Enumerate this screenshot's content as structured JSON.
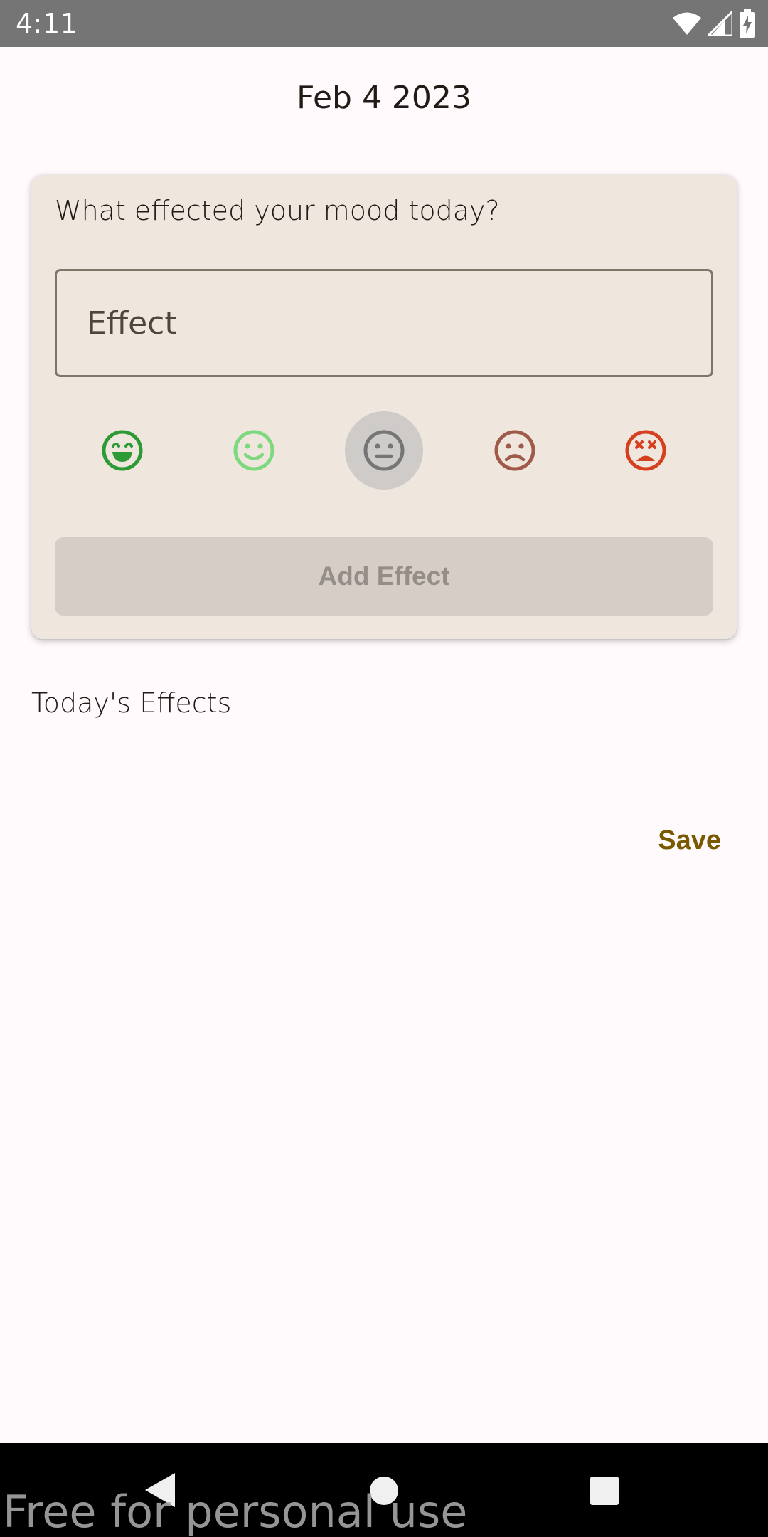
{
  "status_bar": {
    "time": "4:11",
    "icons": [
      "wifi-icon",
      "signal-icon",
      "battery-charging-icon"
    ]
  },
  "header": {
    "date": "Feb 4 2023"
  },
  "effect_card": {
    "question": "What effected your mood today?",
    "effect_field": {
      "label": "Effect",
      "value": ""
    },
    "moods": [
      {
        "name": "very-happy",
        "icon": "grin-face-icon",
        "color": "#2e9a35",
        "selected": false
      },
      {
        "name": "happy",
        "icon": "smile-face-icon",
        "color": "#7dd87f",
        "selected": false
      },
      {
        "name": "neutral",
        "icon": "neutral-face-icon",
        "color": "#757575",
        "selected": true
      },
      {
        "name": "sad",
        "icon": "frown-face-icon",
        "color": "#a05a4a",
        "selected": false
      },
      {
        "name": "very-sad",
        "icon": "dizzy-face-icon",
        "color": "#d5401f",
        "selected": false
      }
    ],
    "add_button_label": "Add Effect"
  },
  "todays_effects": {
    "title": "Today's Effects",
    "items": []
  },
  "save_label": "Save",
  "nav_bar": {
    "icons": [
      "back-icon",
      "home-icon",
      "recents-icon"
    ]
  },
  "watermark": "Free for personal use",
  "colors": {
    "background": "#fffbfd",
    "card": "#efe6de",
    "accent": "#7a5900",
    "status_bar": "#757575"
  }
}
